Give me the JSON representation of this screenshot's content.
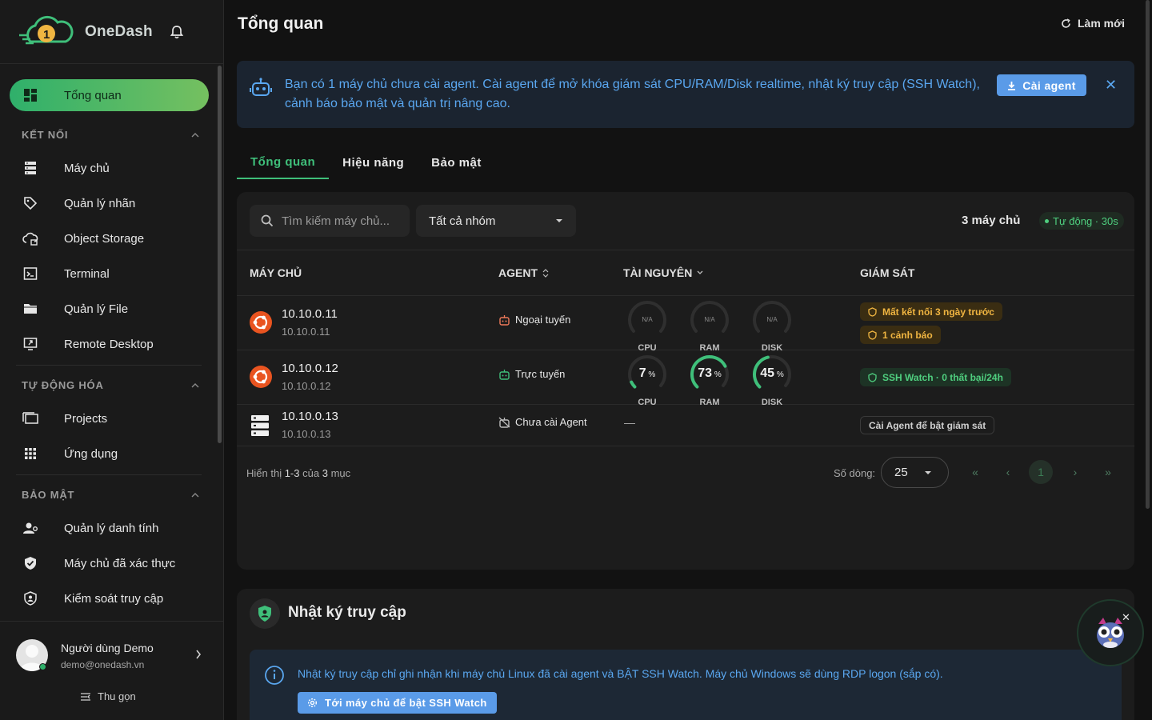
{
  "brand": {
    "name": "OneDash",
    "logo_icon": "onedash-cloud-logo",
    "bell_icon": "bell-icon"
  },
  "sidebar": {
    "active": {
      "label": "Tổng quan",
      "icon": "dashboard-icon"
    },
    "sections": [
      {
        "title": "KẾT NỐI",
        "items": [
          {
            "label": "Máy chủ",
            "icon": "server-icon"
          },
          {
            "label": "Quản lý nhãn",
            "icon": "tag-icon"
          },
          {
            "label": "Object Storage",
            "icon": "cloud-storage-icon"
          },
          {
            "label": "Terminal",
            "icon": "terminal-icon"
          },
          {
            "label": "Quản lý File",
            "icon": "folder-icon"
          },
          {
            "label": "Remote Desktop",
            "icon": "remote-desktop-icon"
          }
        ]
      },
      {
        "title": "TỰ ĐỘNG HÓA",
        "items": [
          {
            "label": "Projects",
            "icon": "projects-icon"
          },
          {
            "label": "Ứng dụng",
            "icon": "apps-grid-icon"
          }
        ]
      },
      {
        "title": "BẢO MẬT",
        "items": [
          {
            "label": "Quản lý danh tính",
            "icon": "identity-icon"
          },
          {
            "label": "Máy chủ đã xác thực",
            "icon": "verified-shield-icon"
          },
          {
            "label": "Kiểm soát truy cập",
            "icon": "access-control-icon"
          }
        ]
      }
    ],
    "user": {
      "name": "Người dùng Demo",
      "email": "demo@onedash.vn"
    },
    "collapse_label": "Thu gọn"
  },
  "header": {
    "title": "Tổng quan",
    "refresh_label": "Làm mới"
  },
  "banner": {
    "message": "Bạn có 1 máy chủ chưa cài agent. Cài agent để mở khóa giám sát CPU/RAM/Disk realtime, nhật ký truy cập (SSH Watch), cảnh báo bảo mật và quản trị nâng cao.",
    "button": "Cài agent"
  },
  "tabs": [
    "Tổng quan",
    "Hiệu năng",
    "Bảo mật"
  ],
  "toolbar": {
    "search_placeholder": "Tìm kiếm máy chủ...",
    "group_value": "Tất cả nhóm",
    "count": "3 máy chủ",
    "auto_label": "Tự động · 30s"
  },
  "table": {
    "headers": [
      "MÁY CHỦ",
      "AGENT",
      "TÀI NGUYÊN",
      "GIÁM SÁT"
    ],
    "gauge_labels": [
      "CPU",
      "RAM",
      "DISK"
    ],
    "na": "N/A",
    "unit": "%",
    "rows": [
      {
        "host": "10.10.0.11",
        "ip": "10.10.0.11",
        "agent": "Ngoại tuyến",
        "cpu": null,
        "ram": null,
        "disk": null,
        "alerts": [
          "Mất kết nối 3 ngày trước",
          "1 cảnh báo"
        ]
      },
      {
        "host": "10.10.0.12",
        "ip": "10.10.0.12",
        "agent": "Trực tuyến",
        "cpu": 7,
        "ram": 73,
        "disk": 45,
        "alerts": [
          "SSH Watch · 0 thất bại/24h"
        ]
      },
      {
        "host": "10.10.0.13",
        "ip": "10.10.0.13",
        "agent": "Chưa cài Agent",
        "resources": "—",
        "alerts": [
          "Cài Agent để bật giám sát"
        ]
      }
    ]
  },
  "pagination": {
    "info_prefix": "Hiển thị",
    "info_range": "1-3",
    "info_mid": "của",
    "info_total": "3",
    "info_suffix": "mục",
    "rows_label": "Số dòng:",
    "rows_value": "25",
    "current_page": "1",
    "first": "«",
    "prev": "‹",
    "next": "›",
    "last": "»"
  },
  "access_log": {
    "title": "Nhật ký truy cập",
    "info": "Nhật ký truy cập chỉ ghi nhận khi máy chủ Linux đã cài agent và BẬT SSH Watch. Máy chủ Windows sẽ dùng RDP logon (sắp có).",
    "button": "Tới máy chủ để bật SSH Watch"
  },
  "colors": {
    "accent": "#3fbf7a",
    "info": "#5aa7f0",
    "warn": "#f0b541",
    "ubuntu": "#e95420"
  }
}
